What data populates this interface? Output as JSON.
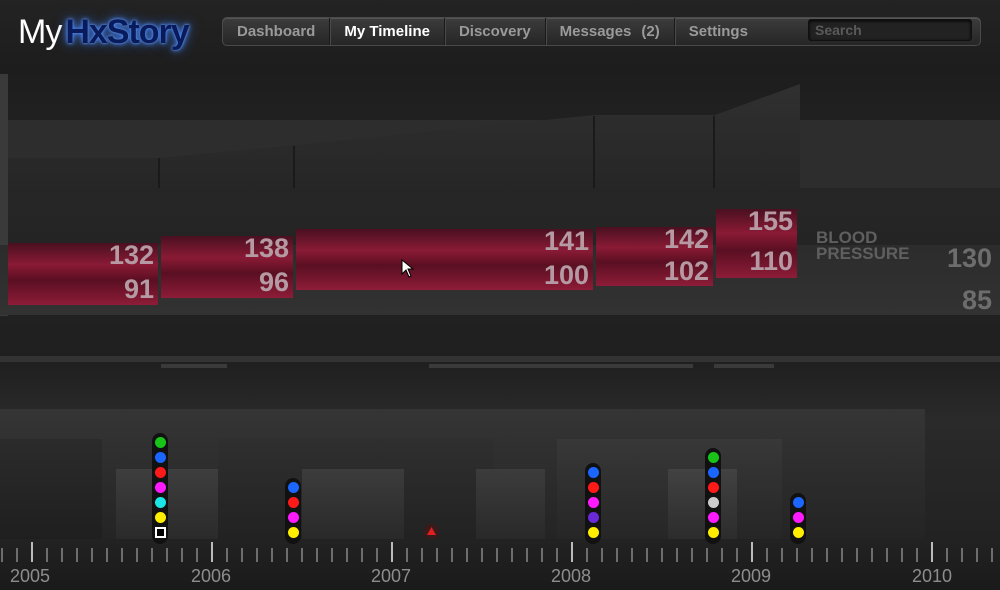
{
  "app": {
    "logo_my": "My",
    "logo_brand": "HxStory"
  },
  "nav": {
    "items": [
      {
        "label": "Dashboard",
        "active": false
      },
      {
        "label": "My Timeline",
        "active": true
      },
      {
        "label": "Discovery",
        "active": false
      },
      {
        "label": "Messages",
        "count": "(2)",
        "active": false
      },
      {
        "label": "Settings",
        "active": false
      }
    ],
    "search_placeholder": "Search"
  },
  "blood_pressure": {
    "label_line1": "BLOOD",
    "label_line2": "PRESSURE",
    "readings": [
      {
        "systolic": "132",
        "diastolic": "91"
      },
      {
        "systolic": "138",
        "diastolic": "96"
      },
      {
        "systolic": "141",
        "diastolic": "100"
      },
      {
        "systolic": "142",
        "diastolic": "102"
      },
      {
        "systolic": "155",
        "diastolic": "110"
      }
    ],
    "reference": {
      "systolic": "130",
      "diastolic": "85"
    }
  },
  "events": [
    {
      "year": "2005",
      "colors": [
        "#19c419",
        "#1a66ff",
        "#ff1a1a",
        "#ff1aff",
        "#1ae6e6",
        "#ffee00",
        "square"
      ]
    },
    {
      "year": "2006",
      "colors": [
        "#1a66ff",
        "#ff1a1a",
        "#ff1aff",
        "#ffee00"
      ]
    },
    {
      "year": "2007",
      "colors": [
        "warning"
      ]
    },
    {
      "year": "2008",
      "colors": [
        "#1a66ff",
        "#ff1a1a",
        "#ff1aff",
        "#6a2ad6",
        "#ffee00"
      ]
    },
    {
      "year": "2008b",
      "colors": [
        "#19c419",
        "#1a66ff",
        "#ff1a1a",
        "#cccccc",
        "#ff1aff",
        "#ffee00"
      ]
    },
    {
      "year": "2009",
      "colors": [
        "#1a66ff",
        "#ff1aff",
        "#ffee00"
      ]
    }
  ],
  "axis": {
    "years": [
      "2005",
      "2006",
      "2007",
      "2008",
      "2009",
      "2010"
    ]
  }
}
